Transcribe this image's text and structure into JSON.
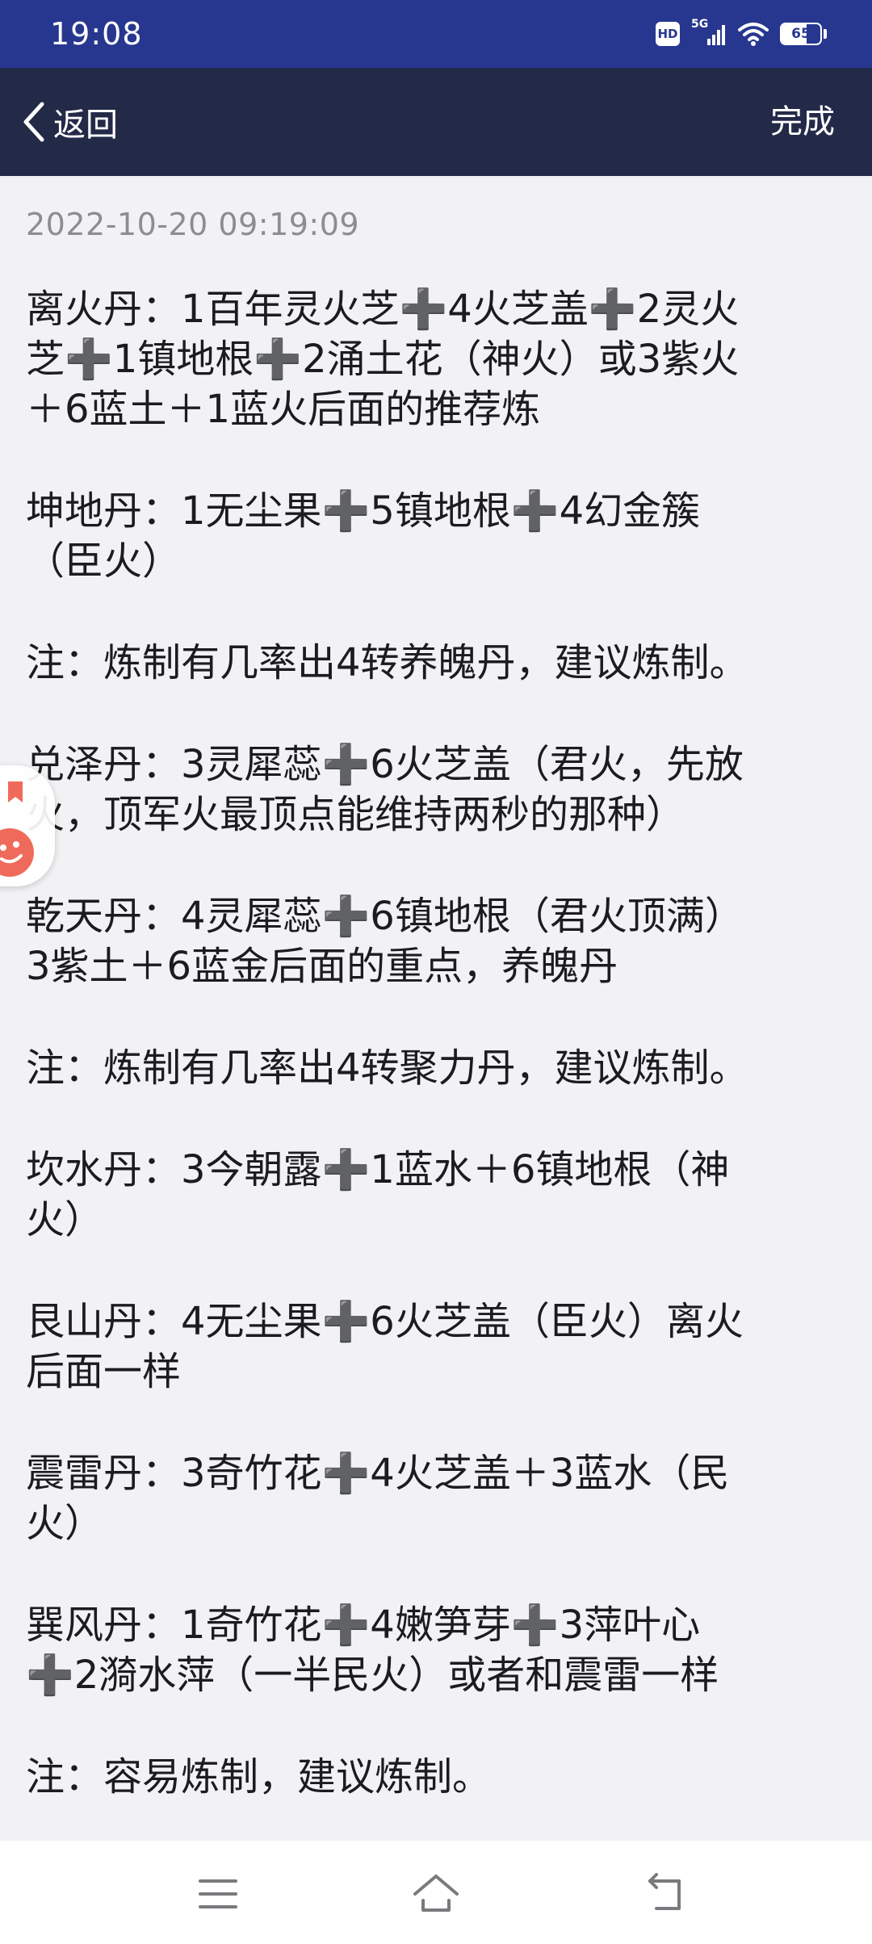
{
  "status_bar": {
    "time": "19:08",
    "hd_label": "HD",
    "network_label": "5G",
    "battery_level": "65",
    "battery_fraction": 0.65
  },
  "nav_bar": {
    "back_label": "返回",
    "done_label": "完成"
  },
  "note": {
    "timestamp": "2022-10-20 09:19:09",
    "paragraphs": [
      [
        "离火丹：1百年灵火芝➕4火芝盖➕2灵火",
        "芝➕1镇地根➕2涌土花（神火）或3紫火",
        "＋6蓝土＋1蓝火后面的推荐炼"
      ],
      [
        "坤地丹：1无尘果➕5镇地根➕4幻金簇",
        "（臣火）"
      ],
      [
        "注：炼制有几率出4转养魄丹，建议炼制。"
      ],
      [
        "兑泽丹：3灵犀蕊➕6火芝盖（君火，先放",
        "火，顶军火最顶点能维持两秒的那种）"
      ],
      [
        "乾天丹：4灵犀蕊➕6镇地根（君火顶满）",
        "3紫土＋6蓝金后面的重点，养魄丹"
      ],
      [
        "注：炼制有几率出4转聚力丹，建议炼制。"
      ],
      [
        "坎水丹：3今朝露➕1蓝水＋6镇地根（神",
        "火）"
      ],
      [
        "艮山丹：4无尘果➕6火芝盖（臣火）离火",
        "后面一样"
      ],
      [
        "震雷丹：3奇竹花➕4火芝盖＋3蓝水（民",
        "火）"
      ],
      [
        "巽风丹：1奇竹花➕4嫩笋芽➕3萍叶心",
        "➕2漪水萍（一半民火）或者和震雷一样"
      ],
      [
        "注：容易炼制，建议炼制。"
      ]
    ]
  },
  "icons": {
    "back": "chevron-left-icon",
    "menu": "menu-icon",
    "home": "home-icon",
    "back_nav": "back-nav-icon",
    "floating": "floating-assistant-icon"
  },
  "colors": {
    "status_bar": "#27378f",
    "nav_bar": "#232a48",
    "background": "#f2f2f4",
    "text": "#1c1c1e",
    "timestamp": "#8d8d90",
    "widget_accent": "#f06a5c"
  }
}
